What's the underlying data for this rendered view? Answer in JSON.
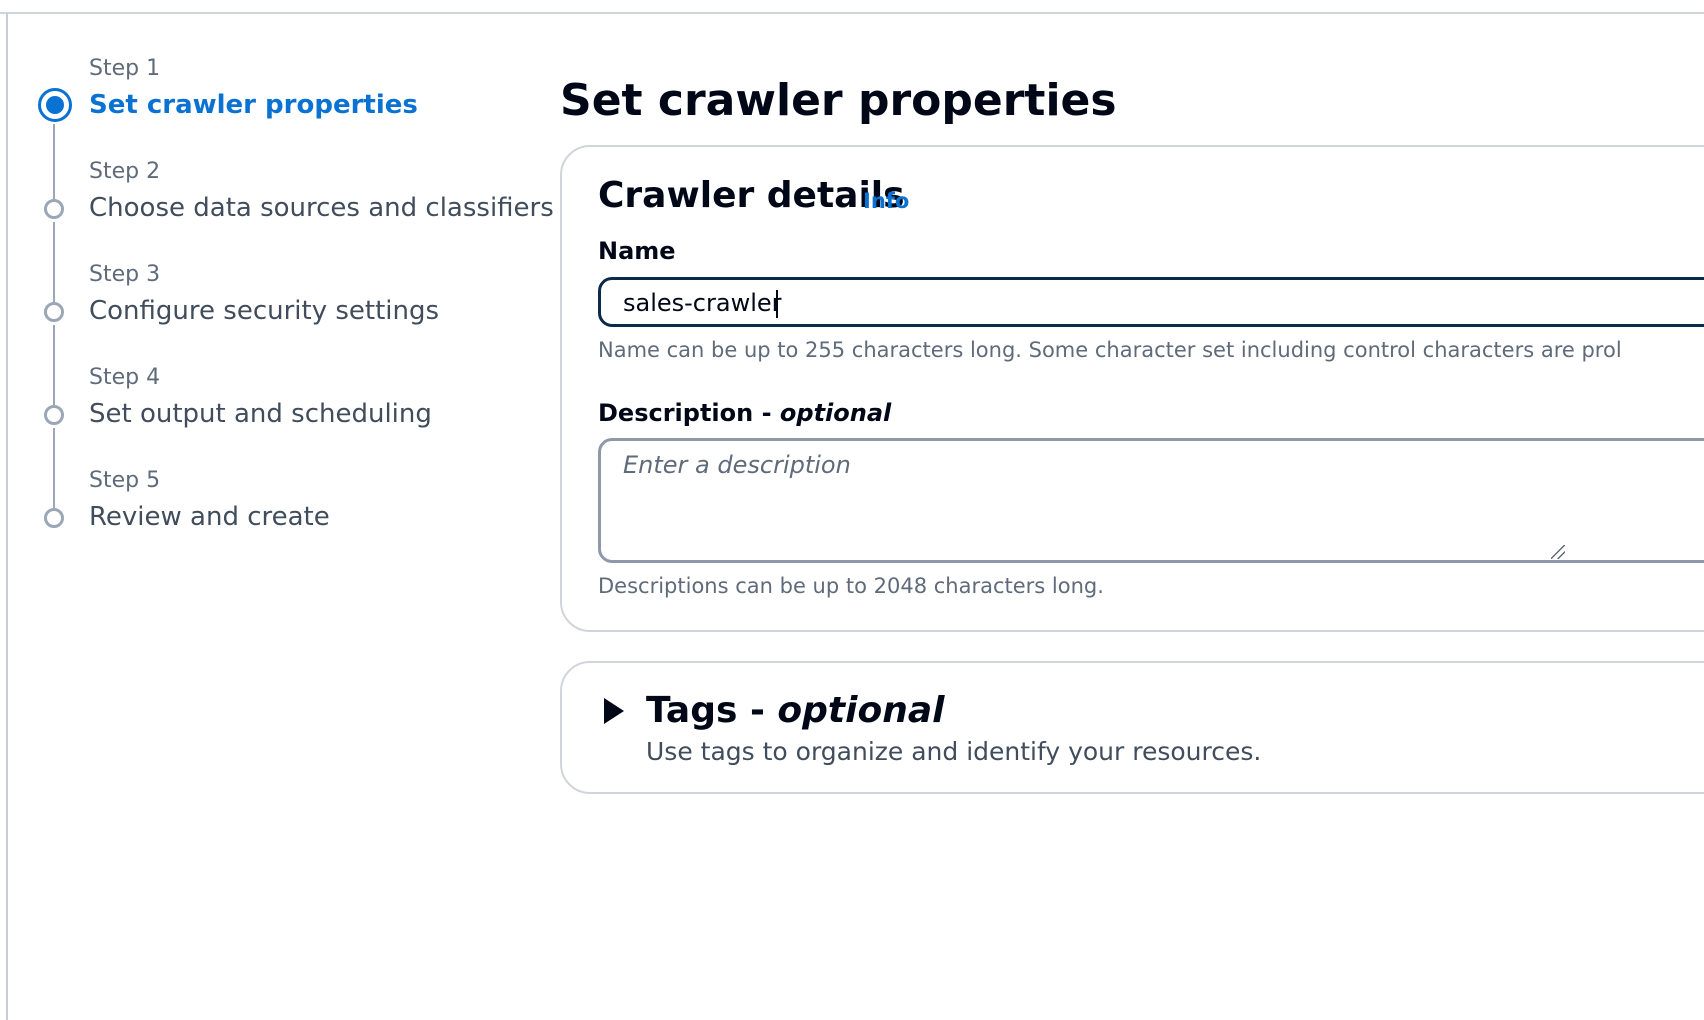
{
  "steps": [
    {
      "number": "Step 1",
      "title": "Set crawler properties",
      "state": "active"
    },
    {
      "number": "Step 2",
      "title": "Choose data sources and classifiers",
      "state": "pending"
    },
    {
      "number": "Step 3",
      "title": "Configure security settings",
      "state": "pending"
    },
    {
      "number": "Step 4",
      "title": "Set output and scheduling",
      "state": "pending"
    },
    {
      "number": "Step 5",
      "title": "Review and create",
      "state": "pending"
    }
  ],
  "page": {
    "title": "Set crawler properties"
  },
  "crawler_details": {
    "heading": "Crawler details",
    "info_link": "Info",
    "name": {
      "label": "Name",
      "value": "sales-crawler",
      "hint": "Name can be up to 255 characters long. Some character set including control characters are prol"
    },
    "description": {
      "label": "Description - ",
      "label_optional": "optional",
      "placeholder": "Enter a description",
      "value": "",
      "hint": "Descriptions can be up to 2048 characters long."
    }
  },
  "tags": {
    "heading": "Tags - ",
    "heading_optional": "optional",
    "description": "Use tags to organize and identify your resources."
  },
  "colors": {
    "accent": "#0972d3",
    "text": "#000716",
    "secondary_text": "#5f6b7a",
    "focus_border": "#0b2a4c"
  },
  "icons": {
    "tags_toggle": "caret-right-icon",
    "active_step": "radio-filled-icon",
    "pending_step": "radio-empty-icon"
  }
}
